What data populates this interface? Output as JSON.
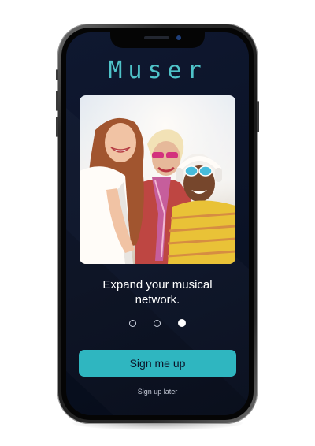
{
  "app": {
    "title": "Muser",
    "accent_color": "#2fb6c0",
    "background_color": "#0b1327"
  },
  "onboarding": {
    "hero_image": "photo of three smiling women at a music festival",
    "tagline": "Expand your musical network.",
    "pager": {
      "total_pages": 3,
      "active_page": 3
    },
    "primary_button_label": "Sign me up",
    "secondary_link_label": "Sign up later"
  }
}
